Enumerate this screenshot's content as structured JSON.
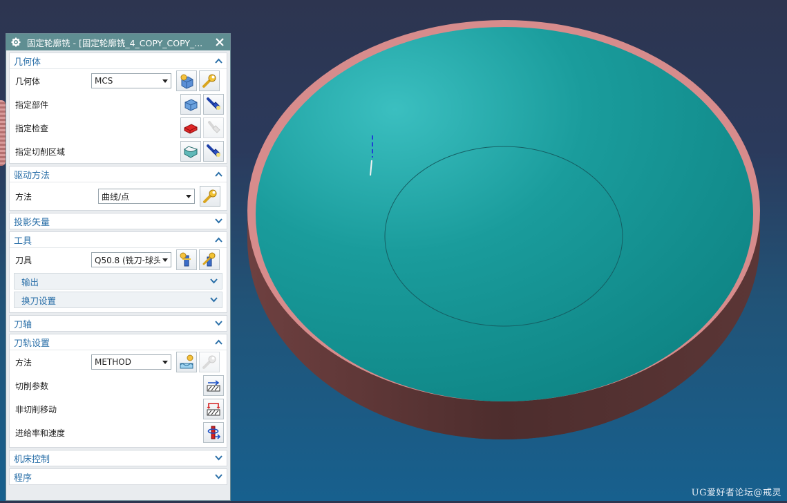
{
  "dialog": {
    "title": "固定轮廓铣 - [固定轮廓铣_4_COPY_COPY_...",
    "icons": {
      "title": "gear-icon",
      "close": "close-icon"
    }
  },
  "geometry": {
    "header": "几何体",
    "geometry_label": "几何体",
    "geometry_value": "MCS",
    "specify_part": "指定部件",
    "specify_check": "指定检查",
    "specify_cut_area": "指定切削区域"
  },
  "drive": {
    "header": "驱动方法",
    "method_label": "方法",
    "method_value": "曲线/点"
  },
  "projection": {
    "header": "投影矢量"
  },
  "tool": {
    "header": "工具",
    "tool_label": "刀具",
    "tool_value": "Q50.8 (铣刀-球头",
    "output": "输出",
    "tool_change": "换刀设置"
  },
  "tool_axis": {
    "header": "刀轴"
  },
  "path_settings": {
    "header": "刀轨设置",
    "method_label": "方法",
    "method_value": "METHOD",
    "cutting_params": "切削参数",
    "non_cutting": "非切削移动",
    "feeds_speeds": "进给率和速度"
  },
  "machine_control": {
    "header": "机床控制"
  },
  "program": {
    "header": "程序"
  },
  "watermark": "UG爱好者论坛@戒灵",
  "colors": {
    "title_bar": "#5f8e92",
    "header_text": "#2a6fa8",
    "part_surface": "#1fa3a3",
    "part_rim": "#d78c8c",
    "part_side": "#5a3434"
  }
}
